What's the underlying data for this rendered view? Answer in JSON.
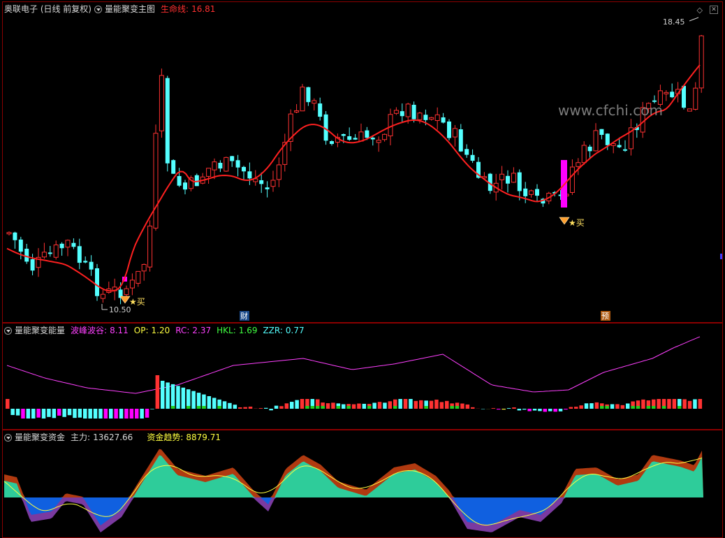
{
  "main_panel": {
    "title": "奥联电子 (日线 前复权)",
    "indicator_name": "量能聚变主图",
    "life_line_label": "生命线:",
    "life_line_value": "16.81",
    "watermark": "www.cfchi.com",
    "high_label": "18.45",
    "low_label": "10.50",
    "buy_label_1": "买",
    "buy_label_2": "买",
    "badge_cai": "财",
    "badge_yu": "预",
    "window_controls": [
      "diamond-icon",
      "close-icon"
    ]
  },
  "energy_panel": {
    "title": "量能聚变能量",
    "items": [
      {
        "label": "波峰波谷:",
        "value": "8.11"
      },
      {
        "label": "OP:",
        "value": "1.20"
      },
      {
        "label": "RC:",
        "value": "2.37"
      },
      {
        "label": "HKL:",
        "value": "1.69"
      },
      {
        "label": "ZZR:",
        "value": "0.77"
      }
    ]
  },
  "fund_panel": {
    "title": "量能聚变资金",
    "main_label": "主力:",
    "main_value": "13627.66",
    "trend_label": "资金趋势:",
    "trend_value": "8879.71"
  },
  "colors": {
    "up": "#ff3232",
    "down": "#54ffff",
    "life_line": "#ff2020",
    "magenta": "#ff00ff",
    "energy_line": "#ff40ff",
    "fund_green": "#2ecc9a",
    "fund_brown": "#b03a10",
    "fund_purple": "#7a3aa0",
    "fund_blue": "#1060e0",
    "trend_line": "#ffff40"
  }
}
